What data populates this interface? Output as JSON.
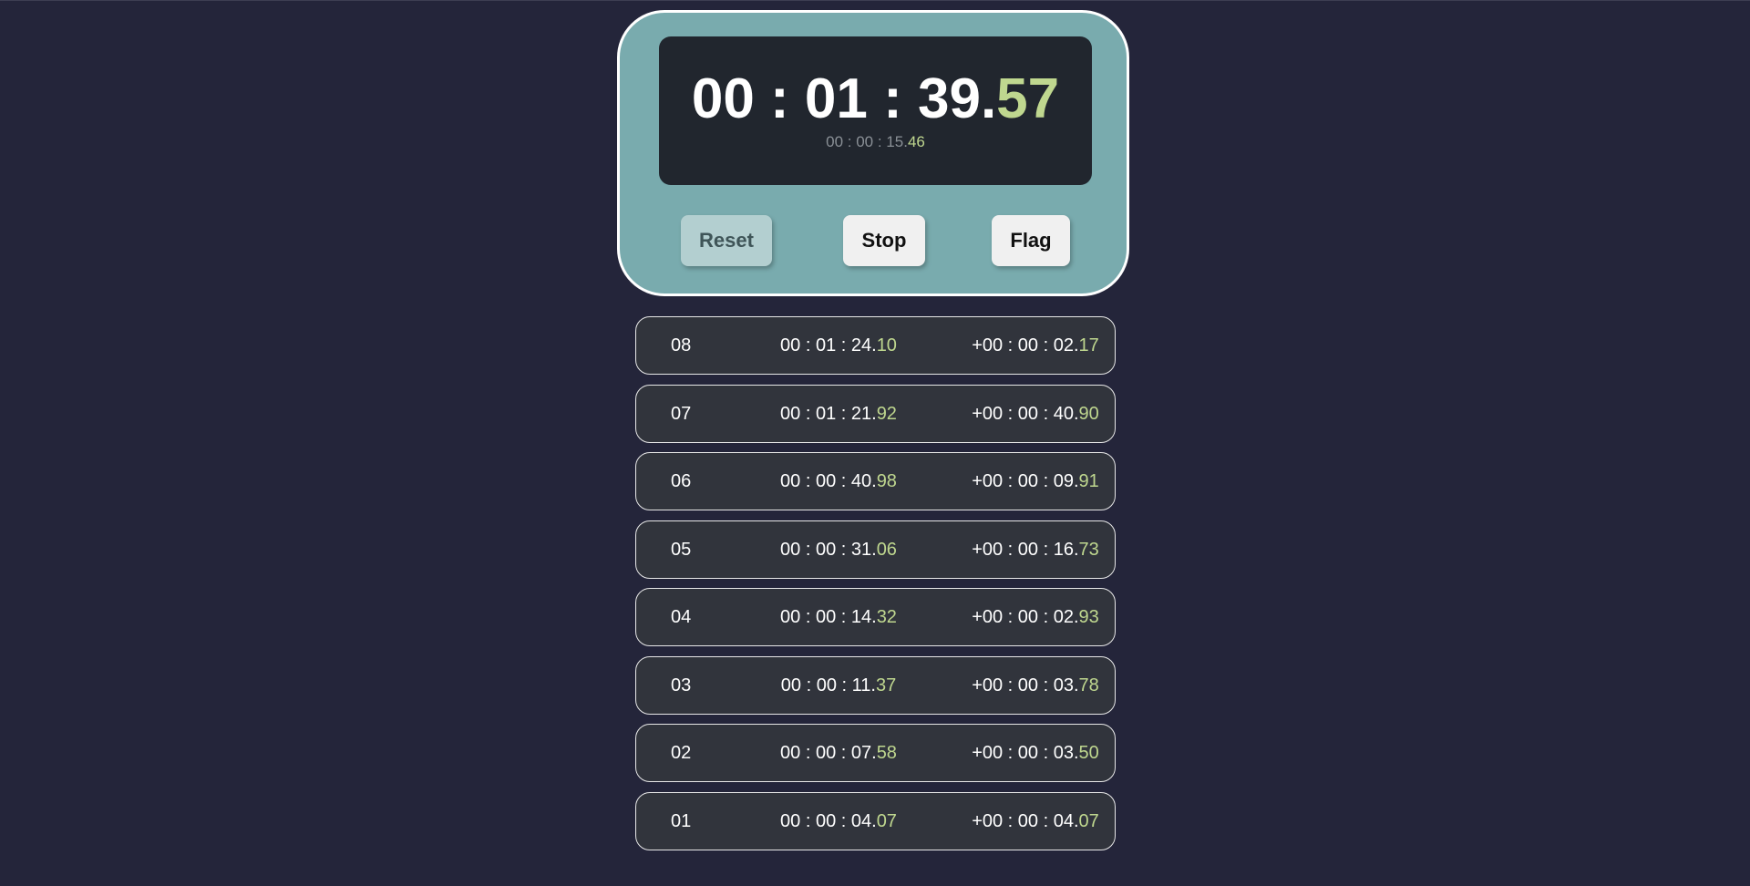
{
  "stopwatch": {
    "main_time": {
      "base": "00 : 01 : 39.",
      "centis": "57"
    },
    "lap_time": {
      "base": "00 : 00 : 15.",
      "centis": "46"
    },
    "buttons": {
      "reset": "Reset",
      "stop": "Stop",
      "flag": "Flag"
    }
  },
  "laps": [
    {
      "num": "08",
      "total_base": "00 : 01 : 24.",
      "total_centis": "10",
      "delta_base": "+00 : 00 : 02.",
      "delta_centis": "17"
    },
    {
      "num": "07",
      "total_base": "00 : 01 : 21.",
      "total_centis": "92",
      "delta_base": "+00 : 00 : 40.",
      "delta_centis": "90"
    },
    {
      "num": "06",
      "total_base": "00 : 00 : 40.",
      "total_centis": "98",
      "delta_base": "+00 : 00 : 09.",
      "delta_centis": "91"
    },
    {
      "num": "05",
      "total_base": "00 : 00 : 31.",
      "total_centis": "06",
      "delta_base": "+00 : 00 : 16.",
      "delta_centis": "73"
    },
    {
      "num": "04",
      "total_base": "00 : 00 : 14.",
      "total_centis": "32",
      "delta_base": "+00 : 00 : 02.",
      "delta_centis": "93"
    },
    {
      "num": "03",
      "total_base": "00 : 00 : 11.",
      "total_centis": "37",
      "delta_base": "+00 : 00 : 03.",
      "delta_centis": "78"
    },
    {
      "num": "02",
      "total_base": "00 : 00 : 07.",
      "total_centis": "58",
      "delta_base": "+00 : 00 : 03.",
      "delta_centis": "50"
    },
    {
      "num": "01",
      "total_base": "00 : 00 : 04.",
      "total_centis": "07",
      "delta_base": "+00 : 00 : 04.",
      "delta_centis": "07"
    }
  ],
  "colors": {
    "background": "#24253a",
    "panel": "#79abae",
    "display": "#21262e",
    "highlight": "#bfd78f",
    "lap_row": "#31343c"
  }
}
